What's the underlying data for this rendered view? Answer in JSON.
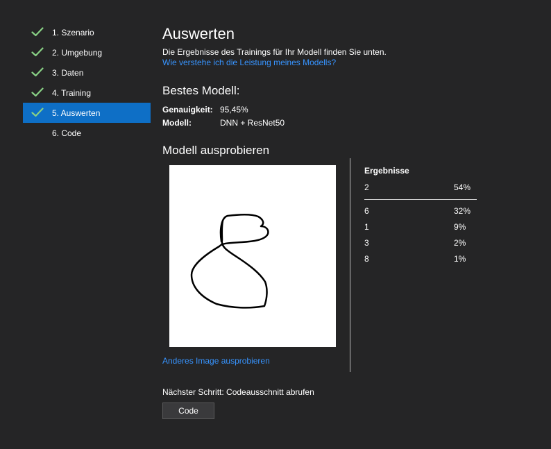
{
  "sidebar": {
    "steps": [
      {
        "label": "1. Szenario",
        "done": true
      },
      {
        "label": "2. Umgebung",
        "done": true
      },
      {
        "label": "3. Daten",
        "done": true
      },
      {
        "label": "4. Training",
        "done": true
      },
      {
        "label": "5. Auswerten",
        "done": true,
        "active": true
      },
      {
        "label": "6. Code",
        "done": false
      }
    ]
  },
  "main": {
    "title": "Auswerten",
    "intro": "Die Ergebnisse des Trainings für Ihr Modell finden Sie unten.",
    "help_link": "Wie verstehe ich die Leistung meines Modells?",
    "best_model": {
      "title": "Bestes Modell:",
      "accuracy_label": "Genauigkeit:",
      "accuracy_value": "95,45%",
      "model_label": "Modell:",
      "model_value": "DNN + ResNet50"
    },
    "try_model": {
      "title": "Modell ausprobieren",
      "other_image_link": "Anderes Image ausprobieren"
    },
    "results": {
      "title": "Ergebnisse",
      "rows": [
        {
          "label": "2",
          "pct": "54%"
        },
        {
          "label": "6",
          "pct": "32%"
        },
        {
          "label": "1",
          "pct": "9%"
        },
        {
          "label": "3",
          "pct": "2%"
        },
        {
          "label": "8",
          "pct": "1%"
        }
      ]
    },
    "next_step": "Nächster Schritt: Codeausschnitt abrufen",
    "code_button": "Code"
  },
  "colors": {
    "background": "#252526",
    "active_step": "#0e6fc6",
    "check": "#89d185",
    "link": "#3794ff"
  }
}
